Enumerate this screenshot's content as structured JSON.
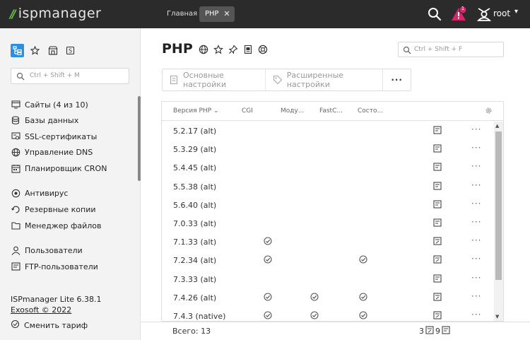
{
  "app": {
    "logo_text": "ispmanager"
  },
  "tabs": [
    {
      "label": "Главная"
    },
    {
      "label": "PHP",
      "close": "✕"
    }
  ],
  "header": {
    "user": "root",
    "alert_count": "1",
    "colors": {
      "bar": "#2b2b2b",
      "alert": "#d8266c",
      "logo_accent": "#6cc04a"
    }
  },
  "sidebar": {
    "search_placeholder": "Ctrl + Shift + M",
    "items": [
      {
        "label": "Сайты (4 из 10)",
        "icon": "sites-icon"
      },
      {
        "label": "Базы данных",
        "icon": "database-icon"
      },
      {
        "label": "SSL-сертификаты",
        "icon": "certificate-icon"
      },
      {
        "label": "Управление DNS",
        "icon": "globe-icon"
      },
      {
        "label": "Планировщик CRON",
        "icon": "calendar-icon"
      },
      {
        "label": "Антивирус",
        "icon": "antivirus-icon"
      },
      {
        "label": "Резервные копии",
        "icon": "backup-icon"
      },
      {
        "label": "Менеджер файлов",
        "icon": "folder-icon"
      },
      {
        "label": "Пользователи",
        "icon": "user-icon"
      },
      {
        "label": "FTP-пользователи",
        "icon": "ftp-icon"
      }
    ],
    "version": "ISPmanager Lite 6.38.1",
    "copyright": "Exosoft © 2022",
    "change_plan": "Сменить тариф"
  },
  "main": {
    "title": "PHP",
    "search_placeholder": "Ctrl + Shift + F",
    "toolbar": {
      "basic": "Основные настройки",
      "advanced": "Расширенные настройки",
      "more": "···"
    },
    "table": {
      "columns": [
        "Версия PHP",
        "CGI",
        "Моду...",
        "FastC...",
        "Состо..."
      ],
      "rows": [
        {
          "version": "5.2.17 (alt)",
          "cgi": false,
          "module": false,
          "fastcgi": false,
          "status": false,
          "status_icon": "doc"
        },
        {
          "version": "5.3.29 (alt)",
          "cgi": false,
          "module": false,
          "fastcgi": false,
          "status": false,
          "status_icon": "doc"
        },
        {
          "version": "5.4.45 (alt)",
          "cgi": false,
          "module": false,
          "fastcgi": false,
          "status": false,
          "status_icon": "doc"
        },
        {
          "version": "5.5.38 (alt)",
          "cgi": false,
          "module": false,
          "fastcgi": false,
          "status": false,
          "status_icon": "doc"
        },
        {
          "version": "5.6.40 (alt)",
          "cgi": false,
          "module": false,
          "fastcgi": false,
          "status": false,
          "status_icon": "doc"
        },
        {
          "version": "7.0.33 (alt)",
          "cgi": false,
          "module": false,
          "fastcgi": false,
          "status": false,
          "status_icon": "doc"
        },
        {
          "version": "7.1.33 (alt)",
          "cgi": true,
          "module": false,
          "fastcgi": false,
          "status": false,
          "status_icon": "doc-edit"
        },
        {
          "version": "7.2.34 (alt)",
          "cgi": true,
          "module": false,
          "fastcgi": false,
          "status": true,
          "status_icon": "doc-edit"
        },
        {
          "version": "7.3.33 (alt)",
          "cgi": false,
          "module": false,
          "fastcgi": false,
          "status": false,
          "status_icon": "doc"
        },
        {
          "version": "7.4.26 (alt)",
          "cgi": true,
          "module": true,
          "fastcgi": true,
          "status": false,
          "status_icon": "doc-edit"
        },
        {
          "version": "7.4.3 (native)",
          "cgi": true,
          "module": true,
          "fastcgi": true,
          "status": false,
          "status_icon": "doc-edit"
        }
      ],
      "row_menu": "···"
    },
    "footer": {
      "total": "Всего: 13",
      "count_a": "3",
      "count_b": "9"
    }
  }
}
